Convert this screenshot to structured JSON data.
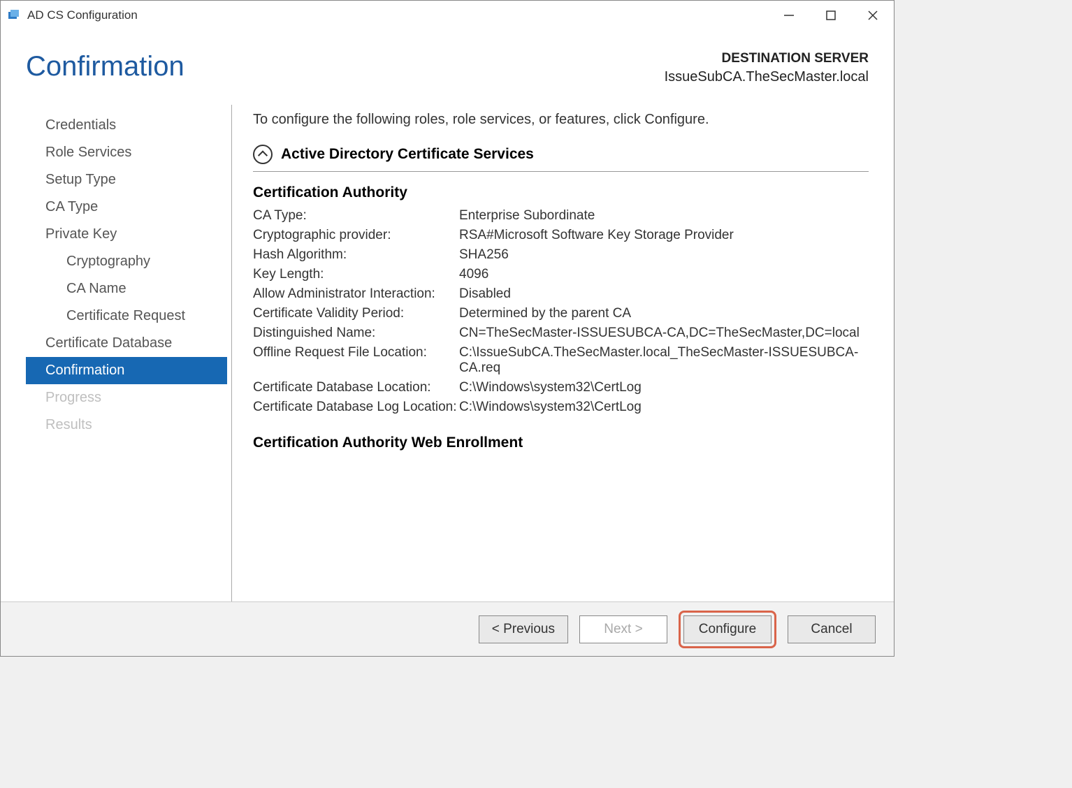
{
  "window": {
    "title": "AD CS Configuration"
  },
  "page": {
    "title": "Confirmation"
  },
  "destination": {
    "label": "DESTINATION SERVER",
    "server": "IssueSubCA.TheSecMaster.local"
  },
  "sidebar": {
    "items": [
      {
        "label": "Credentials",
        "indent": false,
        "selected": false,
        "disabled": false
      },
      {
        "label": "Role Services",
        "indent": false,
        "selected": false,
        "disabled": false
      },
      {
        "label": "Setup Type",
        "indent": false,
        "selected": false,
        "disabled": false
      },
      {
        "label": "CA Type",
        "indent": false,
        "selected": false,
        "disabled": false
      },
      {
        "label": "Private Key",
        "indent": false,
        "selected": false,
        "disabled": false
      },
      {
        "label": "Cryptography",
        "indent": true,
        "selected": false,
        "disabled": false
      },
      {
        "label": "CA Name",
        "indent": true,
        "selected": false,
        "disabled": false
      },
      {
        "label": "Certificate Request",
        "indent": true,
        "selected": false,
        "disabled": false
      },
      {
        "label": "Certificate Database",
        "indent": false,
        "selected": false,
        "disabled": false
      },
      {
        "label": "Confirmation",
        "indent": false,
        "selected": true,
        "disabled": false
      },
      {
        "label": "Progress",
        "indent": false,
        "selected": false,
        "disabled": true
      },
      {
        "label": "Results",
        "indent": false,
        "selected": false,
        "disabled": true
      }
    ]
  },
  "main": {
    "intro": "To configure the following roles, role services, or features, click Configure.",
    "collapsible_title": "Active Directory Certificate Services",
    "section1_heading": "Certification Authority",
    "rows": [
      {
        "key": "CA Type:",
        "val": "Enterprise Subordinate"
      },
      {
        "key": "Cryptographic provider:",
        "val": "RSA#Microsoft Software Key Storage Provider"
      },
      {
        "key": "Hash Algorithm:",
        "val": "SHA256"
      },
      {
        "key": "Key Length:",
        "val": "4096"
      },
      {
        "key": "Allow Administrator Interaction:",
        "val": "Disabled"
      },
      {
        "key": "Certificate Validity Period:",
        "val": "Determined by the parent CA"
      },
      {
        "key": "Distinguished Name:",
        "val": "CN=TheSecMaster-ISSUESUBCA-CA,DC=TheSecMaster,DC=local"
      },
      {
        "key": "Offline Request File Location:",
        "val": "C:\\IssueSubCA.TheSecMaster.local_TheSecMaster-ISSUESUBCA-CA.req"
      },
      {
        "key": "Certificate Database Location:",
        "val": "C:\\Windows\\system32\\CertLog"
      },
      {
        "key": "Certificate Database Log Location:",
        "val": "C:\\Windows\\system32\\CertLog"
      }
    ],
    "section2_heading": "Certification Authority Web Enrollment"
  },
  "footer": {
    "previous": "< Previous",
    "next": "Next >",
    "configure": "Configure",
    "cancel": "Cancel"
  }
}
